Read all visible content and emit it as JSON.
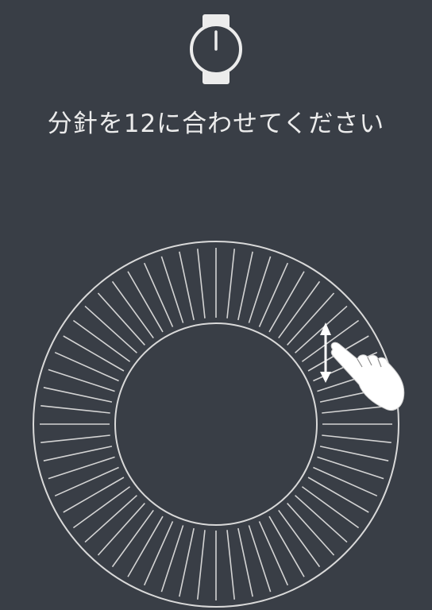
{
  "screen": {
    "instruction": "分針を12に合わせてください",
    "background_color": "#393e46",
    "foreground_color": "#ececec"
  },
  "icons": {
    "watch": "watch-icon",
    "gesture": "swipe-vertical-hand-icon"
  },
  "dial": {
    "tick_count": 60
  }
}
